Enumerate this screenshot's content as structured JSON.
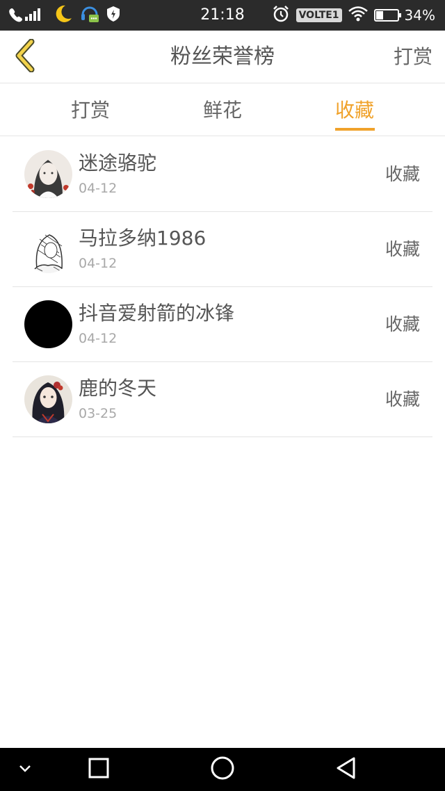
{
  "status_bar": {
    "network": "4.5G",
    "time": "21:18",
    "volte": "VOLTE1",
    "battery": "34%",
    "battery_level": 0.34
  },
  "header": {
    "title": "粉丝荣誉榜",
    "action": "打赏",
    "back_icon": "chevron-left-icon"
  },
  "tabs": [
    {
      "label": "打赏",
      "active": false
    },
    {
      "label": "鲜花",
      "active": false
    },
    {
      "label": "收藏",
      "active": true
    }
  ],
  "fans": [
    {
      "name": "迷途骆驼",
      "date": "04-12",
      "action": "收藏"
    },
    {
      "name": "马拉多纳1986",
      "date": "04-12",
      "action": "收藏"
    },
    {
      "name": "抖音爱射箭的冰锋",
      "date": "04-12",
      "action": "收藏"
    },
    {
      "name": "鹿的冬天",
      "date": "03-25",
      "action": "收藏"
    }
  ],
  "colors": {
    "accent": "#f0a22b",
    "status_bar": "#2b2b2b",
    "nav_bar": "#000000",
    "divider": "#e3e3e3"
  },
  "nav": {
    "icons": [
      "chevron-down-icon",
      "recent-apps-icon",
      "home-icon",
      "back-icon"
    ]
  }
}
